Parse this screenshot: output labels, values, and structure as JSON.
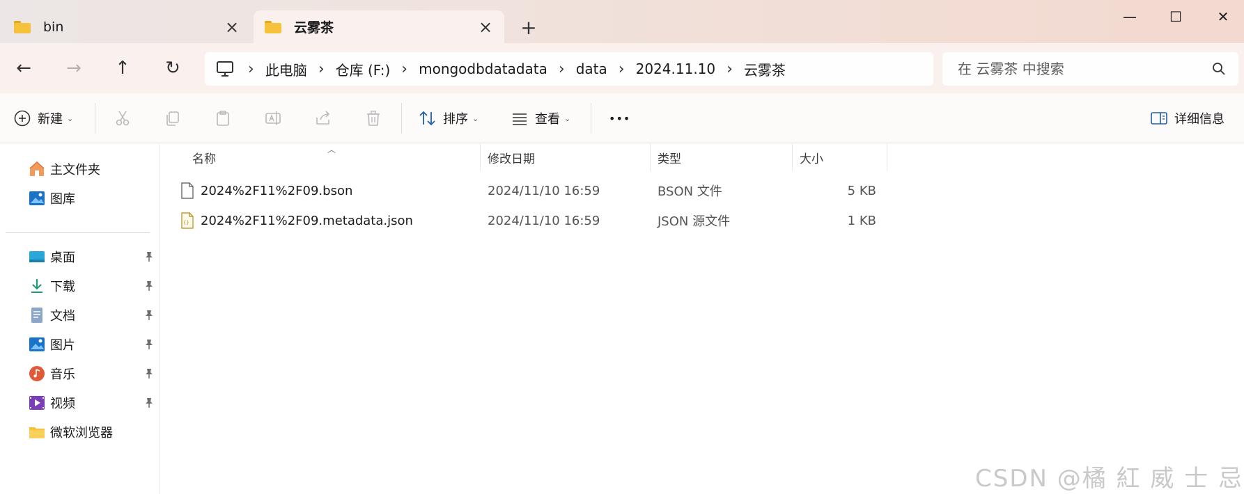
{
  "tabs": [
    {
      "label": "bin",
      "active": false
    },
    {
      "label": "云雾茶",
      "active": true
    }
  ],
  "window_controls": {
    "minimize": "—",
    "maximize": "☐",
    "close": "✕"
  },
  "nav": {
    "back": "←",
    "forward": "→",
    "up": "↑",
    "refresh": "↻"
  },
  "breadcrumb": [
    "此电脑",
    "仓库 (F:)",
    "mongodbdatadata",
    "data",
    "2024.11.10",
    "云雾茶"
  ],
  "search": {
    "placeholder": "在 云雾茶 中搜索"
  },
  "toolbar": {
    "new_label": "新建",
    "sort_label": "排序",
    "view_label": "查看",
    "more_label": "•••",
    "details_label": "详细信息"
  },
  "sidebar": {
    "top_items": [
      {
        "label": "主文件夹",
        "icon": "home-icon"
      },
      {
        "label": "图库",
        "icon": "gallery-icon"
      }
    ],
    "pinned_items": [
      {
        "label": "桌面",
        "icon": "desktop-icon",
        "pinned": true
      },
      {
        "label": "下载",
        "icon": "download-icon",
        "pinned": true
      },
      {
        "label": "文档",
        "icon": "document-icon",
        "pinned": true
      },
      {
        "label": "图片",
        "icon": "pictures-icon",
        "pinned": true
      },
      {
        "label": "音乐",
        "icon": "music-icon",
        "pinned": true
      },
      {
        "label": "视频",
        "icon": "video-icon",
        "pinned": true
      },
      {
        "label": "微软浏览器",
        "icon": "folder-icon",
        "pinned": false
      }
    ]
  },
  "columns": {
    "name": "名称",
    "modified": "修改日期",
    "type": "类型",
    "size": "大小"
  },
  "files": [
    {
      "name": "2024%2F11%2F09.bson",
      "modified": "2024/11/10 16:59",
      "type": "BSON 文件",
      "size": "5 KB",
      "icon": "file-icon"
    },
    {
      "name": "2024%2F11%2F09.metadata.json",
      "modified": "2024/11/10 16:59",
      "type": "JSON 源文件",
      "size": "1 KB",
      "icon": "json-file-icon"
    }
  ],
  "watermark": "CSDN @橘 紅 威 士 忌、",
  "colors": {
    "accent": "#0067c0",
    "titlebar": "#f0e2dc",
    "folder": "#f7c23b"
  }
}
